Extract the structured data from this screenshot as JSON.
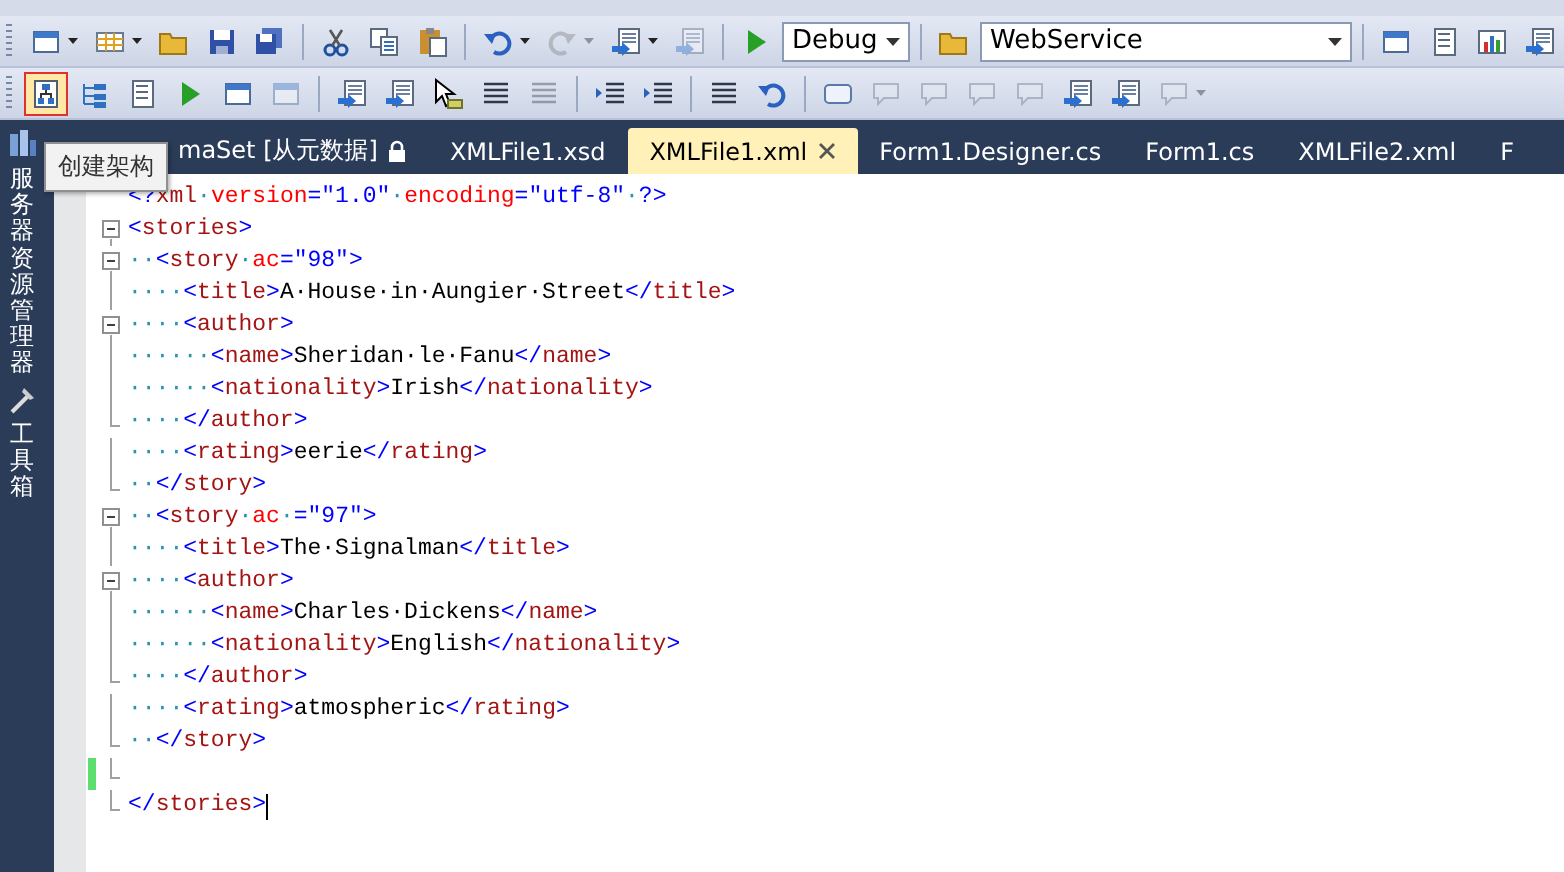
{
  "toolbar_1": {
    "items": [
      {
        "kind": "button",
        "disabled": false,
        "hovered": false
      },
      {
        "kind": "button",
        "disabled": false,
        "hovered": false
      },
      {
        "kind": "button",
        "disabled": false,
        "hovered": false
      },
      {
        "kind": "button",
        "disabled": false,
        "hovered": false
      },
      {
        "kind": "button",
        "disabled": false,
        "hovered": false
      },
      {
        "kind": "separator"
      },
      {
        "kind": "button",
        "disabled": false,
        "hovered": false
      },
      {
        "kind": "button",
        "disabled": false,
        "hovered": false
      },
      {
        "kind": "button",
        "disabled": false,
        "hovered": false
      },
      {
        "kind": "separator"
      },
      {
        "kind": "button",
        "disabled": false,
        "hovered": false
      },
      {
        "kind": "button",
        "disabled": true,
        "hovered": false
      },
      {
        "kind": "button",
        "disabled": false,
        "hovered": false
      },
      {
        "kind": "button",
        "disabled": true,
        "hovered": false
      },
      {
        "kind": "separator"
      },
      {
        "kind": "button",
        "disabled": false,
        "hovered": false
      },
      {
        "kind": "dropdown",
        "value": "Debug"
      },
      {
        "kind": "separator"
      },
      {
        "kind": "button",
        "disabled": false,
        "hovered": false
      },
      {
        "kind": "dropdown",
        "value": "WebService"
      },
      {
        "kind": "separator"
      },
      {
        "kind": "button",
        "disabled": false,
        "hovered": false
      },
      {
        "kind": "button",
        "disabled": false,
        "hovered": false
      },
      {
        "kind": "button",
        "disabled": false,
        "hovered": false
      },
      {
        "kind": "button",
        "disabled": false,
        "hovered": false
      }
    ]
  },
  "toolbar_2": {
    "items": [
      {
        "kind": "button",
        "disabled": false,
        "hovered": true
      },
      {
        "kind": "button",
        "disabled": false,
        "hovered": false
      },
      {
        "kind": "button",
        "disabled": false,
        "hovered": false
      },
      {
        "kind": "button",
        "disabled": false,
        "hovered": false
      },
      {
        "kind": "button",
        "disabled": false,
        "hovered": false
      },
      {
        "kind": "button",
        "disabled": true,
        "hovered": false
      },
      {
        "kind": "separator"
      },
      {
        "kind": "button",
        "disabled": false,
        "hovered": false
      },
      {
        "kind": "button",
        "disabled": false,
        "hovered": false
      },
      {
        "kind": "button",
        "disabled": false,
        "hovered": false
      },
      {
        "kind": "button",
        "disabled": false,
        "hovered": false
      },
      {
        "kind": "button",
        "disabled": true,
        "hovered": false
      },
      {
        "kind": "separator"
      },
      {
        "kind": "button",
        "disabled": false,
        "hovered": false
      },
      {
        "kind": "button",
        "disabled": false,
        "hovered": false
      },
      {
        "kind": "separator"
      },
      {
        "kind": "button",
        "disabled": false,
        "hovered": false
      },
      {
        "kind": "button",
        "disabled": false,
        "hovered": false
      },
      {
        "kind": "separator"
      },
      {
        "kind": "button",
        "disabled": false,
        "hovered": false
      },
      {
        "kind": "button",
        "disabled": true,
        "hovered": false
      },
      {
        "kind": "button",
        "disabled": true,
        "hovered": false
      },
      {
        "kind": "button",
        "disabled": true,
        "hovered": false
      },
      {
        "kind": "button",
        "disabled": true,
        "hovered": false
      },
      {
        "kind": "button",
        "disabled": false,
        "hovered": false
      },
      {
        "kind": "button",
        "disabled": false,
        "hovered": false
      },
      {
        "kind": "button",
        "disabled": true,
        "hovered": false
      }
    ]
  },
  "tooltip": "创建架构",
  "sidebar": {
    "items": [
      {
        "label": "服务器资源管理器"
      },
      {
        "label": "工具箱"
      }
    ]
  },
  "tabs": [
    {
      "label": "maSet [从元数据]",
      "locked": true,
      "selected": false
    },
    {
      "label": "XMLFile1.xsd",
      "locked": false,
      "selected": false
    },
    {
      "label": "XMLFile1.xml",
      "locked": false,
      "selected": true
    },
    {
      "label": "Form1.Designer.cs",
      "locked": false,
      "selected": false
    },
    {
      "label": "Form1.cs",
      "locked": false,
      "selected": false
    },
    {
      "label": "XMLFile2.xml",
      "locked": false,
      "selected": false
    },
    {
      "label": "F",
      "locked": false,
      "selected": false
    }
  ],
  "editor": {
    "lines": [
      {
        "changed": false,
        "tokens": [
          {
            "kind": "b",
            "text": "<?"
          },
          {
            "kind": "n",
            "text": "xml"
          },
          {
            "kind": "w",
            "text": "·"
          },
          {
            "kind": "a",
            "text": "version"
          },
          {
            "kind": "b",
            "text": "=\"1.0\""
          },
          {
            "kind": "w",
            "text": "·"
          },
          {
            "kind": "a",
            "text": "encoding"
          },
          {
            "kind": "b",
            "text": "=\"utf-8\""
          },
          {
            "kind": "w",
            "text": "·"
          },
          {
            "kind": "b",
            "text": "?>"
          }
        ]
      },
      {
        "changed": false,
        "tokens": [
          {
            "kind": "b",
            "text": "<"
          },
          {
            "kind": "n",
            "text": "stories"
          },
          {
            "kind": "b",
            "text": ">"
          }
        ]
      },
      {
        "changed": false,
        "tokens": [
          {
            "kind": "w",
            "text": "··"
          },
          {
            "kind": "b",
            "text": "<"
          },
          {
            "kind": "n",
            "text": "story"
          },
          {
            "kind": "w",
            "text": "·"
          },
          {
            "kind": "a",
            "text": "ac"
          },
          {
            "kind": "b",
            "text": "=\"98\">"
          }
        ]
      },
      {
        "changed": false,
        "tokens": [
          {
            "kind": "w",
            "text": "····"
          },
          {
            "kind": "b",
            "text": "<"
          },
          {
            "kind": "n",
            "text": "title"
          },
          {
            "kind": "b",
            "text": ">"
          },
          {
            "kind": "t",
            "text": "A·House·in·Aungier·Street"
          },
          {
            "kind": "b",
            "text": "</"
          },
          {
            "kind": "n",
            "text": "title"
          },
          {
            "kind": "b",
            "text": ">"
          }
        ]
      },
      {
        "changed": false,
        "tokens": [
          {
            "kind": "w",
            "text": "····"
          },
          {
            "kind": "b",
            "text": "<"
          },
          {
            "kind": "n",
            "text": "author"
          },
          {
            "kind": "b",
            "text": ">"
          }
        ]
      },
      {
        "changed": false,
        "tokens": [
          {
            "kind": "w",
            "text": "······"
          },
          {
            "kind": "b",
            "text": "<"
          },
          {
            "kind": "n",
            "text": "name"
          },
          {
            "kind": "b",
            "text": ">"
          },
          {
            "kind": "t",
            "text": "Sheridan·le·Fanu"
          },
          {
            "kind": "b",
            "text": "</"
          },
          {
            "kind": "n",
            "text": "name"
          },
          {
            "kind": "b",
            "text": ">"
          }
        ]
      },
      {
        "changed": false,
        "tokens": [
          {
            "kind": "w",
            "text": "······"
          },
          {
            "kind": "b",
            "text": "<"
          },
          {
            "kind": "n",
            "text": "nationality"
          },
          {
            "kind": "b",
            "text": ">"
          },
          {
            "kind": "t",
            "text": "Irish"
          },
          {
            "kind": "b",
            "text": "</"
          },
          {
            "kind": "n",
            "text": "nationality"
          },
          {
            "kind": "b",
            "text": ">"
          }
        ]
      },
      {
        "changed": false,
        "tokens": [
          {
            "kind": "w",
            "text": "····"
          },
          {
            "kind": "b",
            "text": "</"
          },
          {
            "kind": "n",
            "text": "author"
          },
          {
            "kind": "b",
            "text": ">"
          }
        ]
      },
      {
        "changed": false,
        "tokens": [
          {
            "kind": "w",
            "text": "····"
          },
          {
            "kind": "b",
            "text": "<"
          },
          {
            "kind": "n",
            "text": "rating"
          },
          {
            "kind": "b",
            "text": ">"
          },
          {
            "kind": "t",
            "text": "eerie"
          },
          {
            "kind": "b",
            "text": "</"
          },
          {
            "kind": "n",
            "text": "rating"
          },
          {
            "kind": "b",
            "text": ">"
          }
        ]
      },
      {
        "changed": false,
        "tokens": [
          {
            "kind": "w",
            "text": "··"
          },
          {
            "kind": "b",
            "text": "</"
          },
          {
            "kind": "n",
            "text": "story"
          },
          {
            "kind": "b",
            "text": ">"
          }
        ]
      },
      {
        "changed": false,
        "tokens": [
          {
            "kind": "w",
            "text": "··"
          },
          {
            "kind": "b",
            "text": "<"
          },
          {
            "kind": "n",
            "text": "story"
          },
          {
            "kind": "w",
            "text": "·"
          },
          {
            "kind": "a",
            "text": "ac"
          },
          {
            "kind": "w",
            "text": "·"
          },
          {
            "kind": "b",
            "text": "=\"97\">"
          }
        ]
      },
      {
        "changed": false,
        "tokens": [
          {
            "kind": "w",
            "text": "····"
          },
          {
            "kind": "b",
            "text": "<"
          },
          {
            "kind": "n",
            "text": "title"
          },
          {
            "kind": "b",
            "text": ">"
          },
          {
            "kind": "t",
            "text": "The·Signalman"
          },
          {
            "kind": "b",
            "text": "</"
          },
          {
            "kind": "n",
            "text": "title"
          },
          {
            "kind": "b",
            "text": ">"
          }
        ]
      },
      {
        "changed": false,
        "tokens": [
          {
            "kind": "w",
            "text": "····"
          },
          {
            "kind": "b",
            "text": "<"
          },
          {
            "kind": "n",
            "text": "author"
          },
          {
            "kind": "b",
            "text": ">"
          }
        ]
      },
      {
        "changed": false,
        "tokens": [
          {
            "kind": "w",
            "text": "······"
          },
          {
            "kind": "b",
            "text": "<"
          },
          {
            "kind": "n",
            "text": "name"
          },
          {
            "kind": "b",
            "text": ">"
          },
          {
            "kind": "t",
            "text": "Charles·Dickens"
          },
          {
            "kind": "b",
            "text": "</"
          },
          {
            "kind": "n",
            "text": "name"
          },
          {
            "kind": "b",
            "text": ">"
          }
        ]
      },
      {
        "changed": false,
        "tokens": [
          {
            "kind": "w",
            "text": "······"
          },
          {
            "kind": "b",
            "text": "<"
          },
          {
            "kind": "n",
            "text": "nationality"
          },
          {
            "kind": "b",
            "text": ">"
          },
          {
            "kind": "t",
            "text": "English"
          },
          {
            "kind": "b",
            "text": "</"
          },
          {
            "kind": "n",
            "text": "nationality"
          },
          {
            "kind": "b",
            "text": ">"
          }
        ]
      },
      {
        "changed": false,
        "tokens": [
          {
            "kind": "w",
            "text": "····"
          },
          {
            "kind": "b",
            "text": "</"
          },
          {
            "kind": "n",
            "text": "author"
          },
          {
            "kind": "b",
            "text": ">"
          }
        ]
      },
      {
        "changed": false,
        "tokens": [
          {
            "kind": "w",
            "text": "····"
          },
          {
            "kind": "b",
            "text": "<"
          },
          {
            "kind": "n",
            "text": "rating"
          },
          {
            "kind": "b",
            "text": ">"
          },
          {
            "kind": "t",
            "text": "atmospheric"
          },
          {
            "kind": "b",
            "text": "</"
          },
          {
            "kind": "n",
            "text": "rating"
          },
          {
            "kind": "b",
            "text": ">"
          }
        ]
      },
      {
        "changed": false,
        "tokens": [
          {
            "kind": "w",
            "text": "··"
          },
          {
            "kind": "b",
            "text": "</"
          },
          {
            "kind": "n",
            "text": "story"
          },
          {
            "kind": "b",
            "text": ">"
          }
        ]
      },
      {
        "changed": true
      },
      {
        "changed": false,
        "cursor": true,
        "tokens": [
          {
            "kind": "b",
            "text": "</"
          },
          {
            "kind": "n",
            "text": "stories"
          },
          {
            "kind": "b",
            "text": ">"
          }
        ]
      }
    ]
  }
}
